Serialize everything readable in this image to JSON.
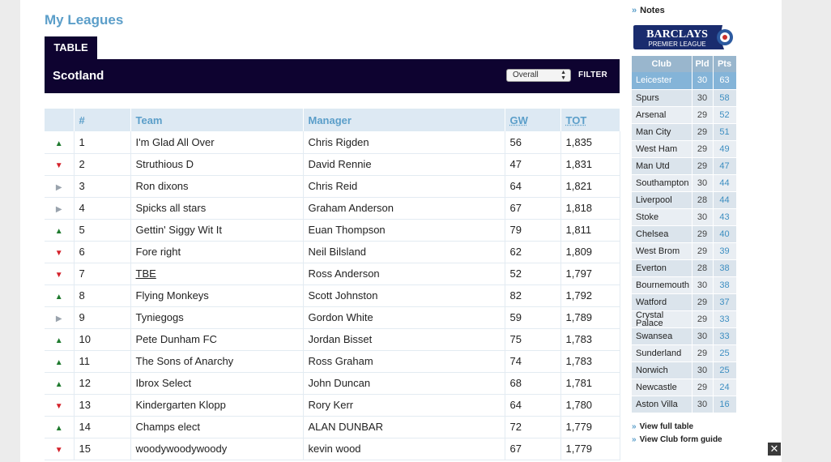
{
  "page": {
    "title": "My Leagues",
    "tab": "TABLE",
    "league_name": "Scotland",
    "filter_select": "Overall",
    "filter_button": "FILTER"
  },
  "table": {
    "columns": [
      "#",
      "Team",
      "Manager",
      "GW",
      "TOT"
    ],
    "rows": [
      {
        "move": "up",
        "rank": "1",
        "team": "I'm Glad All Over",
        "manager": "Chris Rigden",
        "gw": "56",
        "tot": "1,835"
      },
      {
        "move": "down",
        "rank": "2",
        "team": "Struthious D",
        "manager": "David Rennie",
        "gw": "47",
        "tot": "1,831"
      },
      {
        "move": "same",
        "rank": "3",
        "team": "Ron dixons",
        "manager": "Chris Reid",
        "gw": "64",
        "tot": "1,821"
      },
      {
        "move": "same",
        "rank": "4",
        "team": "Spicks all stars",
        "manager": "Graham Anderson",
        "gw": "67",
        "tot": "1,818"
      },
      {
        "move": "up",
        "rank": "5",
        "team": "Gettin' Siggy Wit It",
        "manager": "Euan Thompson",
        "gw": "79",
        "tot": "1,811"
      },
      {
        "move": "down",
        "rank": "6",
        "team": "Fore right",
        "manager": "Neil Bilsland",
        "gw": "62",
        "tot": "1,809"
      },
      {
        "move": "down",
        "rank": "7",
        "team": "TBE",
        "manager": "Ross Anderson",
        "gw": "52",
        "tot": "1,797"
      },
      {
        "move": "up",
        "rank": "8",
        "team": "Flying Monkeys",
        "manager": "Scott Johnston",
        "gw": "82",
        "tot": "1,792"
      },
      {
        "move": "same",
        "rank": "9",
        "team": "Tyniegogs",
        "manager": "Gordon White",
        "gw": "59",
        "tot": "1,789"
      },
      {
        "move": "up",
        "rank": "10",
        "team": "Pete Dunham FC",
        "manager": "Jordan Bisset",
        "gw": "75",
        "tot": "1,783"
      },
      {
        "move": "up",
        "rank": "11",
        "team": "The Sons of Anarchy",
        "manager": "Ross Graham",
        "gw": "74",
        "tot": "1,783"
      },
      {
        "move": "up",
        "rank": "12",
        "team": "Ibrox Select",
        "manager": "John Duncan",
        "gw": "68",
        "tot": "1,781"
      },
      {
        "move": "down",
        "rank": "13",
        "team": "Kindergarten Klopp",
        "manager": "Rory Kerr",
        "gw": "64",
        "tot": "1,780"
      },
      {
        "move": "up",
        "rank": "14",
        "team": "Champs elect",
        "manager": "ALAN DUNBAR",
        "gw": "72",
        "tot": "1,779"
      },
      {
        "move": "down",
        "rank": "15",
        "team": "woodywoodywoody",
        "manager": "kevin wood",
        "gw": "67",
        "tot": "1,779"
      }
    ]
  },
  "sidebar": {
    "notes_label": "Notes",
    "logo_text_1": "BARCLAYS",
    "logo_text_2": "PREMIER LEAGUE",
    "columns": [
      "Club",
      "Pld",
      "Pts"
    ],
    "clubs": [
      {
        "club": "Leicester",
        "pld": "30",
        "pts": "63"
      },
      {
        "club": "Spurs",
        "pld": "30",
        "pts": "58"
      },
      {
        "club": "Arsenal",
        "pld": "29",
        "pts": "52"
      },
      {
        "club": "Man City",
        "pld": "29",
        "pts": "51"
      },
      {
        "club": "West Ham",
        "pld": "29",
        "pts": "49"
      },
      {
        "club": "Man Utd",
        "pld": "29",
        "pts": "47"
      },
      {
        "club": "Southampton",
        "pld": "30",
        "pts": "44"
      },
      {
        "club": "Liverpool",
        "pld": "28",
        "pts": "44"
      },
      {
        "club": "Stoke",
        "pld": "30",
        "pts": "43"
      },
      {
        "club": "Chelsea",
        "pld": "29",
        "pts": "40"
      },
      {
        "club": "West Brom",
        "pld": "29",
        "pts": "39"
      },
      {
        "club": "Everton",
        "pld": "28",
        "pts": "38"
      },
      {
        "club": "Bournemouth",
        "pld": "30",
        "pts": "38"
      },
      {
        "club": "Watford",
        "pld": "29",
        "pts": "37"
      },
      {
        "club": "Crystal Palace",
        "pld": "29",
        "pts": "33"
      },
      {
        "club": "Swansea",
        "pld": "30",
        "pts": "33"
      },
      {
        "club": "Sunderland",
        "pld": "29",
        "pts": "25"
      },
      {
        "club": "Norwich",
        "pld": "30",
        "pts": "25"
      },
      {
        "club": "Newcastle",
        "pld": "29",
        "pts": "24"
      },
      {
        "club": "Aston Villa",
        "pld": "30",
        "pts": "16"
      }
    ],
    "links": [
      "View full table",
      "View Club form guide"
    ]
  },
  "colors": {
    "up": "#1f7a2e",
    "down": "#d4212a",
    "same": "#9aa3ad",
    "brand": "#0e0330",
    "accent": "#5b9ec9"
  }
}
